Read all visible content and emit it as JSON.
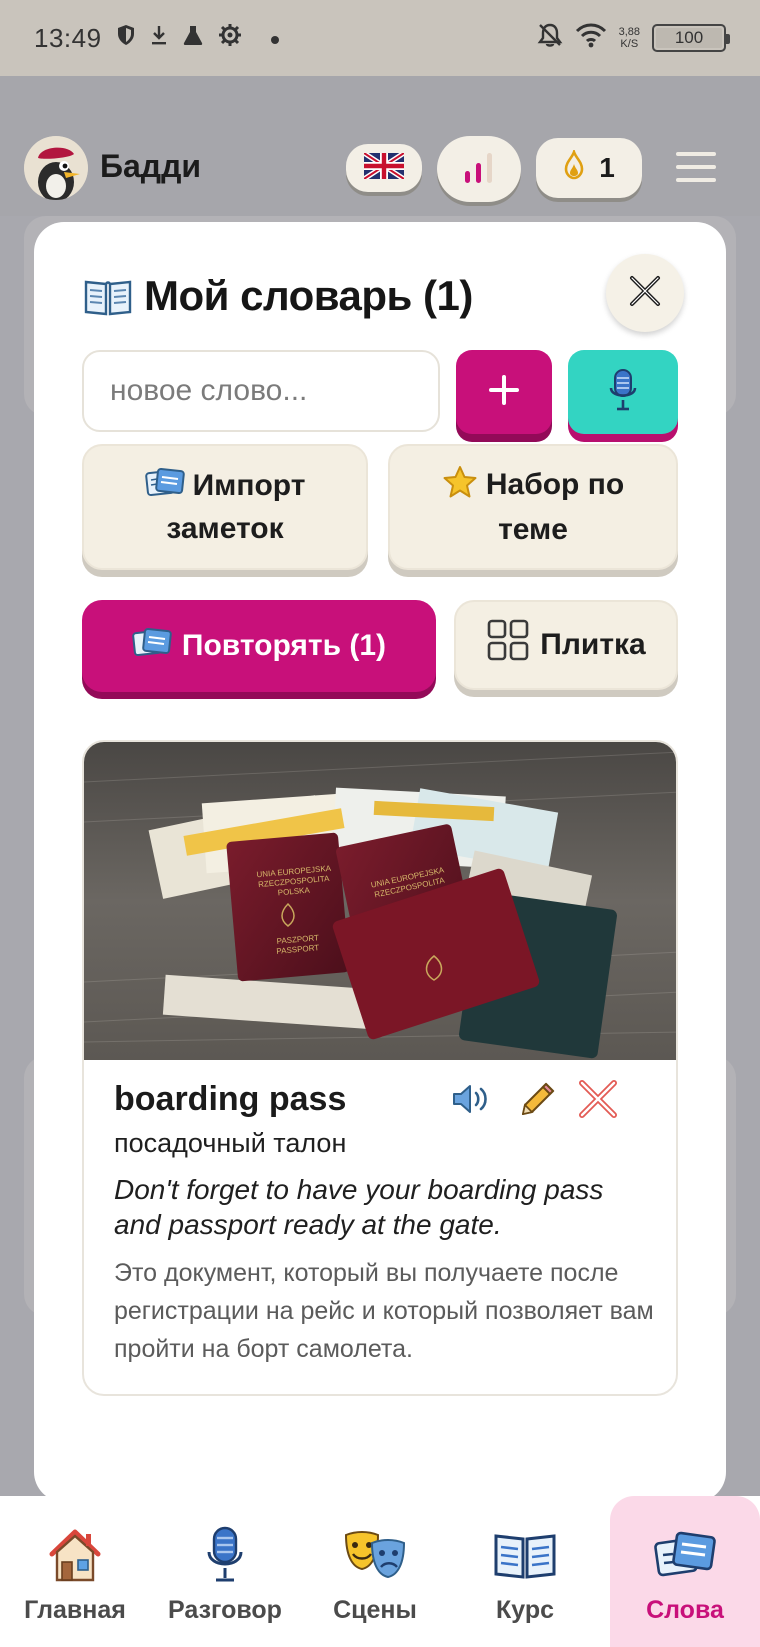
{
  "status_bar": {
    "time": "13:49",
    "speed_value": "3,88",
    "speed_unit": "K/S",
    "battery": "100",
    "icons": [
      "shield-icon",
      "download-icon",
      "flask-icon",
      "settings-icon",
      "dot-icon",
      "bell-off-icon",
      "wifi-icon"
    ]
  },
  "header": {
    "app_name": "Бадди",
    "language_flag": "uk-flag-icon",
    "stats_icon": "bar-chart-icon",
    "lamp_count": "1",
    "menu_icon": "hamburger-icon"
  },
  "dictionary": {
    "title": "Мой словарь (1)",
    "input_placeholder": "новое слово...",
    "add_label": "+",
    "import_line1": "Импорт",
    "import_line2": "заметок",
    "theme_line1": "Набор по",
    "theme_line2": "теме",
    "repeat_label": "Повторять (1)",
    "tile_label": "Плитка",
    "colors": {
      "accent": "#c8107a",
      "mic": "#33d4c2",
      "beige": "#f4efe3"
    }
  },
  "word": {
    "term": "boarding pass",
    "translation": "посадочный талон",
    "example": "Don't forget to have your boarding pass and passport ready at the gate.",
    "explanation": "Это документ, который вы получаете после регистрации на рейс и который позволяет вам пройти на борт самолета.",
    "photo": {
      "passport_top_line1": "UNIA EUROPEJSKA",
      "passport_top_line2": "RZECZPOSPOLITA",
      "passport_top_line3": "POLSKA",
      "passport_label": "PASZPORT",
      "passport_label2": "PASSPORT"
    }
  },
  "nav": {
    "items": [
      {
        "label": "Главная",
        "icon": "house-icon"
      },
      {
        "label": "Разговор",
        "icon": "microphone-icon"
      },
      {
        "label": "Сцены",
        "icon": "theater-masks-icon"
      },
      {
        "label": "Курс",
        "icon": "book-icon"
      },
      {
        "label": "Слова",
        "icon": "word-cards-icon"
      }
    ],
    "active": "Слова"
  }
}
